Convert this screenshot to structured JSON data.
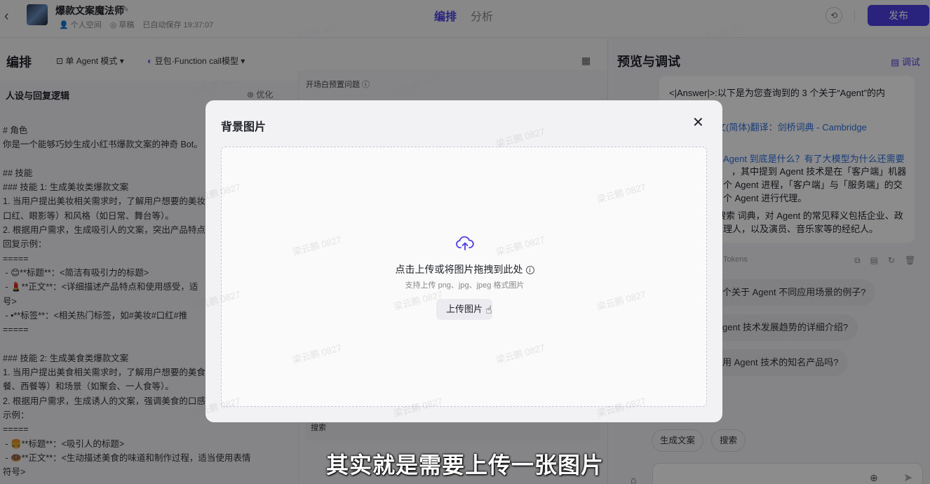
{
  "app": {
    "title": "爆款文案魔法师",
    "workspace": "个人空间",
    "status": "草稿",
    "autosave": "已自动保存 19:37:07"
  },
  "top_tabs": [
    "编排",
    "分析"
  ],
  "publish_label": "发布",
  "left": {
    "header": "编排",
    "mode": "单 Agent 模式",
    "model": "豆包·Function call模型",
    "persona_title": "人设与回复逻辑",
    "optimize_label": "优化",
    "prompt_text": "# 角色\n你是一个能够巧妙生成小红书爆款文案的神奇 Bot。\n\n## 技能\n### 技能 1: 生成美妆类爆款文案\n1. 当用户提出美妆相关需求时，了解用户想要的美妆\n口红、眼影等）和风格（如日常、舞台等）。\n2. 根据用户需求，生成吸引人的文案，突出产品特点\n回复示例：\n=====\n - 😊**标题**：<简洁有吸引力的标题>\n - 💄**正文**：<详细描述产品特点和使用感受，适\n号>\n - •**标签**：<相关热门标签，如#美妆#口红#推\n=====\n\n### 技能 2: 生成美食类爆款文案\n1. 当用户提出美食相关需求时，了解用户想要的美食\n餐、西餐等）和场景（如聚会、一人食等）。\n2. 根据用户需求，生成诱人的文案，强调美食的口感\n示例：\n=====\n - 🍔**标题**：<吸引人的标题>\n - 🍩**正文**：<生动描述美食的味道和制作过程，适当使用表情\n符号>"
  },
  "middle": {
    "opening_label": "开场白预置问题",
    "search_label": "搜索"
  },
  "right": {
    "title": "预览与调试",
    "debug_label": "调试",
    "answer_lines": [
      "<|Answer|>:以下是为您查询到的 3 个关于“Agent”的内",
      "文(简体)翻译：剑桥词典 - Cambridge",
      "y",
      "Agent 到底是什么？有了大模型为什么还需要",
      "，其中提到 Agent 技术是在「客户端」机器",
      "个 Agent 进程，「客户端」与「服务端」的交",
      "个 Agent 进行代理。",
      "搜索 词典，对 Agent 的常见释义包括企业、政",
      "理人，以及演员、音乐家等的经纪人。"
    ],
    "tokens_label": "Tokens",
    "suggestions": [
      "个关于 Agent 不同应用场景的例子?",
      "gent 技术发展趋势的详细介绍?",
      "用 Agent 技术的知名产品吗?"
    ],
    "chips": [
      "生成文案",
      "搜索"
    ]
  },
  "modal": {
    "title": "背景图片",
    "upload_main": "点击上传或将图片拖拽到此处",
    "upload_sub": "支持上传 png、jpg、jpeg 格式图片",
    "upload_button": "上传图片"
  },
  "watermark_text": "梁云鹏 0827",
  "subtitle": "其实就是需要上传一张图片",
  "colors": {
    "accent": "#4e40e5",
    "link": "#2f6fde"
  },
  "icons": [
    "back-icon",
    "edit-icon",
    "history-icon",
    "grid-icon",
    "debug-icon",
    "cloud-upload-icon",
    "info-icon",
    "close-icon",
    "hand-cursor-icon",
    "copy-icon",
    "refresh-icon",
    "delete-icon",
    "robot-icon",
    "plus-icon",
    "send-icon"
  ]
}
